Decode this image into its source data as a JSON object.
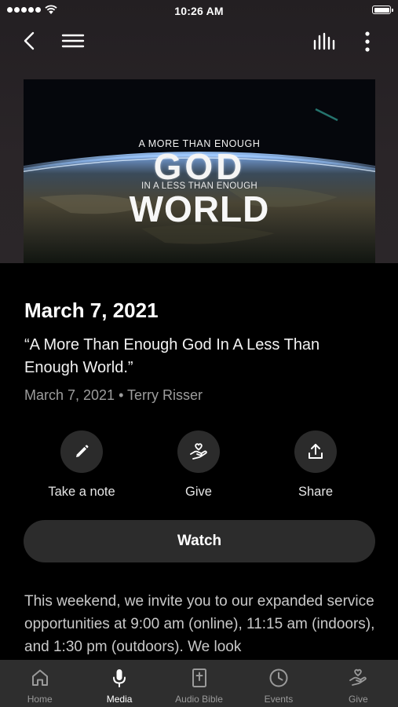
{
  "status_bar": {
    "time": "10:26 AM"
  },
  "hero": {
    "line1": "A MORE THAN ENOUGH",
    "line2": "GOD",
    "line3": "IN A LESS THAN ENOUGH",
    "line4": "WORLD"
  },
  "sermon": {
    "title": "March 7, 2021",
    "quote": "“A More Than Enough God In A Less Than Enough World.”",
    "meta": "March 7, 2021 • Terry Risser"
  },
  "actions": {
    "note_label": "Take a note",
    "give_label": "Give",
    "share_label": "Share"
  },
  "watch_label": "Watch",
  "description": "This weekend, we invite you to our expanded service opportunities at 9:00 am (online), 11:15 am (indoors), and 1:30 pm (outdoors). We look",
  "tabs": [
    {
      "label": "Home",
      "icon": "home-icon"
    },
    {
      "label": "Media",
      "icon": "microphone-icon"
    },
    {
      "label": "Audio Bible",
      "icon": "bible-icon"
    },
    {
      "label": "Events",
      "icon": "clock-icon"
    },
    {
      "label": "Give",
      "icon": "give-hand-icon"
    }
  ],
  "active_tab": "Media",
  "colors": {
    "background": "#000000",
    "header": "#2a2528",
    "button": "#2c2c2c",
    "tab_bar": "#2e2e2e",
    "muted_text": "#9d9d9d"
  }
}
